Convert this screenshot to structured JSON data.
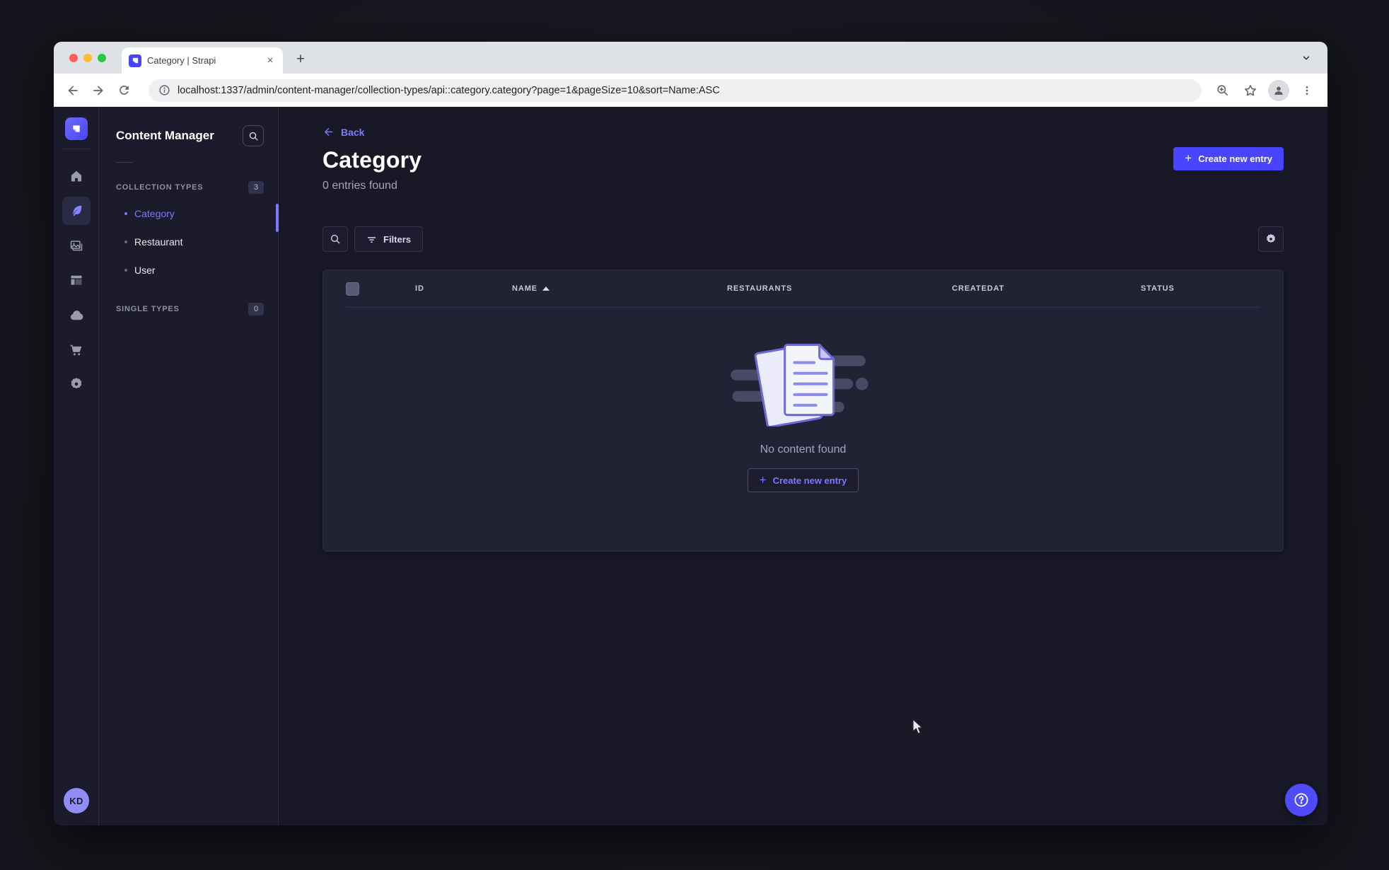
{
  "browser": {
    "tab": {
      "title": "Category | Strapi"
    },
    "url": "localhost:1337/admin/content-manager/collection-types/api::category.category?page=1&pageSize=10&sort=Name:ASC"
  },
  "app": {
    "user_initials": "KD",
    "subnav": {
      "title": "Content Manager",
      "collection_types": {
        "label": "COLLECTION TYPES",
        "badge": "3",
        "items": [
          {
            "label": "Category"
          },
          {
            "label": "Restaurant"
          },
          {
            "label": "User"
          }
        ]
      },
      "single_types": {
        "label": "SINGLE TYPES",
        "badge": "0"
      }
    },
    "header": {
      "back": "Back",
      "title": "Category",
      "subtitle": "0 entries found",
      "create_button": "Create new entry"
    },
    "toolbar": {
      "filters": "Filters"
    },
    "table": {
      "columns": [
        "ID",
        "NAME",
        "RESTAURANTS",
        "CREATEDAT",
        "STATUS"
      ],
      "sorted_column": "NAME",
      "sort_direction": "asc",
      "rows": []
    },
    "empty": {
      "message": "No content found",
      "create_button": "Create new entry"
    }
  },
  "colors": {
    "primary": "#4945ff",
    "accent": "#7b79ff",
    "background": "#181826",
    "card": "#222235"
  }
}
